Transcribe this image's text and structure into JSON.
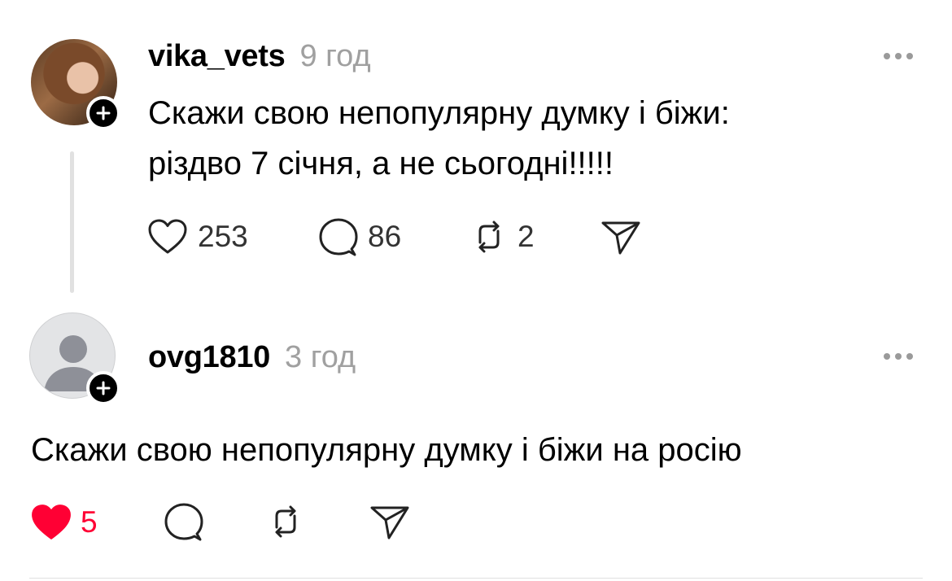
{
  "posts": [
    {
      "username": "vika_vets",
      "time": "9 год",
      "text_line1": "Скажи свою непопулярну думку і біжи:",
      "text_line2": "різдво 7 січня, а не сьогодні!!!!!",
      "likes": "253",
      "comments": "86",
      "reposts": "2",
      "liked": false
    },
    {
      "username": "ovg1810",
      "time": "3 год",
      "text": "Скажи свою непопулярну думку і біжи на росію",
      "likes": "5",
      "liked": true
    }
  ],
  "icons": [
    "plus-icon",
    "more-icon",
    "heart-icon",
    "comment-icon",
    "repost-icon",
    "share-icon",
    "default-avatar-icon"
  ],
  "colors": {
    "liked": "#ff0034",
    "muted": "#a0a0a0"
  }
}
